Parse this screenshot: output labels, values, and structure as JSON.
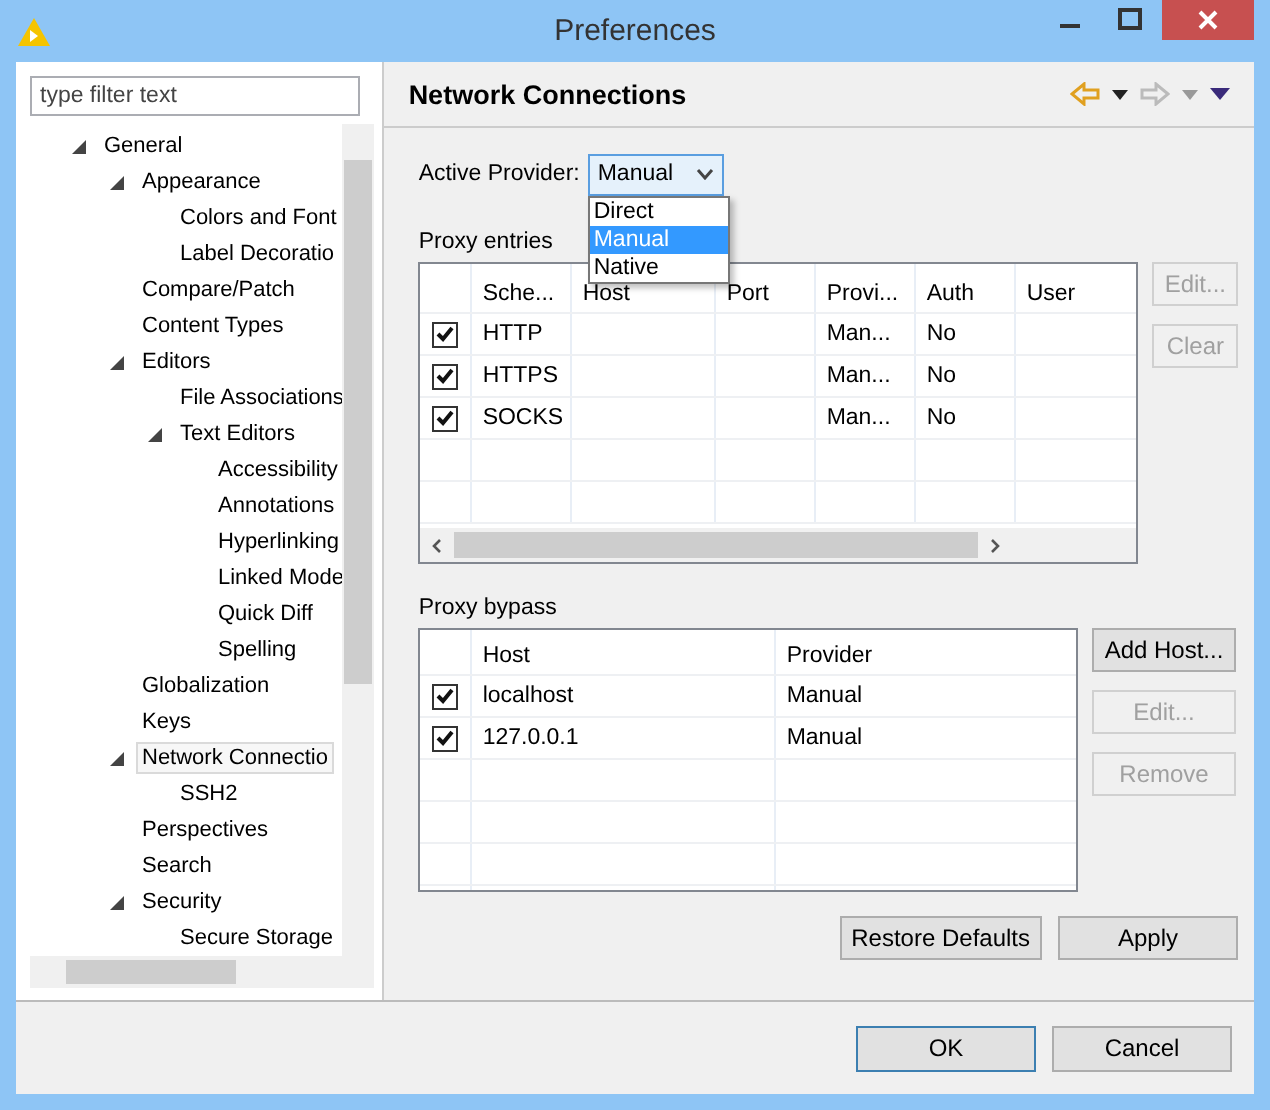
{
  "window": {
    "title": "Preferences"
  },
  "sidebar": {
    "filter": {
      "placeholder": "type filter text"
    },
    "tree": [
      {
        "label": "General",
        "selected": false,
        "expanded": true,
        "children": [
          {
            "label": "Appearance",
            "selected": false,
            "expanded": true,
            "children": [
              {
                "label": "Colors and Font",
                "selected": false
              },
              {
                "label": "Label Decoratio",
                "selected": false
              }
            ]
          },
          {
            "label": "Compare/Patch",
            "selected": false
          },
          {
            "label": "Content Types",
            "selected": false
          },
          {
            "label": "Editors",
            "selected": false,
            "expanded": true,
            "children": [
              {
                "label": "File Associations",
                "selected": false
              },
              {
                "label": "Text Editors",
                "selected": false,
                "expanded": true,
                "children": [
                  {
                    "label": "Accessibility",
                    "selected": false
                  },
                  {
                    "label": "Annotations",
                    "selected": false
                  },
                  {
                    "label": "Hyperlinking",
                    "selected": false
                  },
                  {
                    "label": "Linked Mode",
                    "selected": false
                  },
                  {
                    "label": "Quick Diff",
                    "selected": false
                  },
                  {
                    "label": "Spelling",
                    "selected": false
                  }
                ]
              }
            ]
          },
          {
            "label": "Globalization",
            "selected": false
          },
          {
            "label": "Keys",
            "selected": false
          },
          {
            "label": "Network Connectio",
            "selected": true,
            "expanded": true,
            "children": [
              {
                "label": "SSH2",
                "selected": false
              }
            ]
          },
          {
            "label": "Perspectives",
            "selected": false
          },
          {
            "label": "Search",
            "selected": false
          },
          {
            "label": "Security",
            "selected": false,
            "expanded": true,
            "children": [
              {
                "label": "Secure Storage",
                "selected": false
              }
            ]
          }
        ]
      }
    ]
  },
  "page": {
    "title": "Network Connections"
  },
  "active_provider": {
    "label": "Active Provider:",
    "value": "Manual",
    "options": [
      {
        "label": "Direct",
        "selected": false
      },
      {
        "label": "Manual",
        "selected": true
      },
      {
        "label": "Native",
        "selected": false
      }
    ]
  },
  "proxy_entries": {
    "label": "Proxy entries",
    "columns": [
      "Sche...",
      "Host",
      "Port",
      "Provi...",
      "Auth",
      "User"
    ],
    "rows": [
      {
        "checked": true,
        "scheme": "HTTP",
        "provider": "Man...",
        "auth": "No"
      },
      {
        "checked": true,
        "scheme": "HTTPS",
        "provider": "Man...",
        "auth": "No"
      },
      {
        "checked": true,
        "scheme": "SOCKS",
        "provider": "Man...",
        "auth": "No"
      }
    ],
    "buttons": [
      {
        "label": "Edit...",
        "disabled": true
      },
      {
        "label": "Clear",
        "disabled": true
      }
    ]
  },
  "proxy_bypass": {
    "label": "Proxy bypass",
    "columns": [
      "Host",
      "Provider"
    ],
    "rows": [
      {
        "checked": true,
        "host": "localhost",
        "provider": "Manual"
      },
      {
        "checked": true,
        "host": "127.0.0.1",
        "provider": "Manual"
      }
    ],
    "buttons": [
      {
        "label": "Add Host...",
        "disabled": false
      },
      {
        "label": "Edit...",
        "disabled": true
      },
      {
        "label": "Remove",
        "disabled": true
      }
    ]
  },
  "page_buttons": [
    {
      "label": "Restore Defaults"
    },
    {
      "label": "Apply"
    }
  ],
  "dialog_buttons": [
    {
      "label": "OK",
      "default": true
    },
    {
      "label": "Cancel",
      "default": false
    }
  ]
}
